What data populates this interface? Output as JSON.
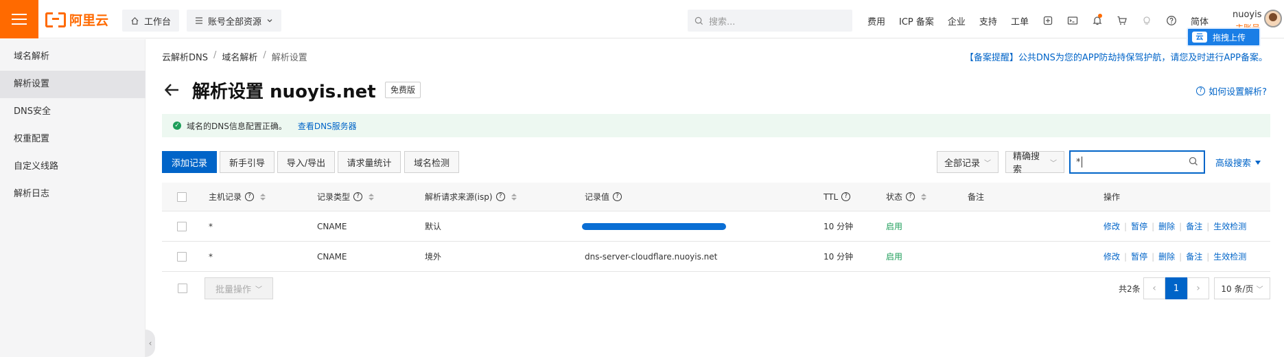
{
  "brand": {
    "name": "阿里云",
    "accent": "#ff6a00",
    "primary": "#0064c8"
  },
  "topbar": {
    "workbench": "工作台",
    "resources": "账号全部资源",
    "search_placeholder": "搜索...",
    "links": [
      "费用",
      "ICP 备案",
      "企业",
      "支持",
      "工单"
    ],
    "lang": "简体",
    "user": "nuoyis",
    "user_sub": "主账号",
    "upload": "拖拽上传",
    "upload_badge": "云"
  },
  "sidebar": {
    "title": "域名解析",
    "items": [
      "解析设置",
      "DNS安全",
      "权重配置",
      "自定义线路",
      "解析日志"
    ],
    "collapse": "‹"
  },
  "breadcrumb": [
    "云解析DNS",
    "域名解析",
    "解析设置"
  ],
  "notice": "【备案提醒】公共DNS为您的APP防劫持保驾护航，请您及时进行APP备案。",
  "page": {
    "title": "解析设置 nuoyis.net",
    "tag": "免费版",
    "help": "如何设置解析?"
  },
  "alert": {
    "text": "域名的DNS信息配置正确。",
    "link": "查看DNS服务器"
  },
  "toolbar": {
    "add": "添加记录",
    "guide": "新手引导",
    "import_export": "导入/导出",
    "stats": "请求量统计",
    "check": "域名检测",
    "filter_all": "全部记录",
    "precise": "精确搜索",
    "search_value": "*",
    "advanced": "高级搜索"
  },
  "table": {
    "headers": {
      "host": "主机记录",
      "type": "记录类型",
      "isp": "解析请求来源(isp)",
      "value": "记录值",
      "ttl": "TTL",
      "status": "状态",
      "remark": "备注",
      "ops": "操作"
    },
    "rows": [
      {
        "host": "*",
        "type": "CNAME",
        "isp": "默认",
        "value": "",
        "value_redacted": true,
        "ttl": "10 分钟",
        "status": "启用",
        "remark": ""
      },
      {
        "host": "*",
        "type": "CNAME",
        "isp": "境外",
        "value": "dns-server-cloudflare.nuoyis.net",
        "value_redacted": false,
        "ttl": "10 分钟",
        "status": "启用",
        "remark": ""
      }
    ],
    "actions": [
      "修改",
      "暂停",
      "删除",
      "备注",
      "生效检测"
    ]
  },
  "footer": {
    "bulk": "批量操作",
    "total": "共2条",
    "prev": "‹",
    "current_page": "1",
    "next": "›",
    "page_size": "10 条/页"
  }
}
